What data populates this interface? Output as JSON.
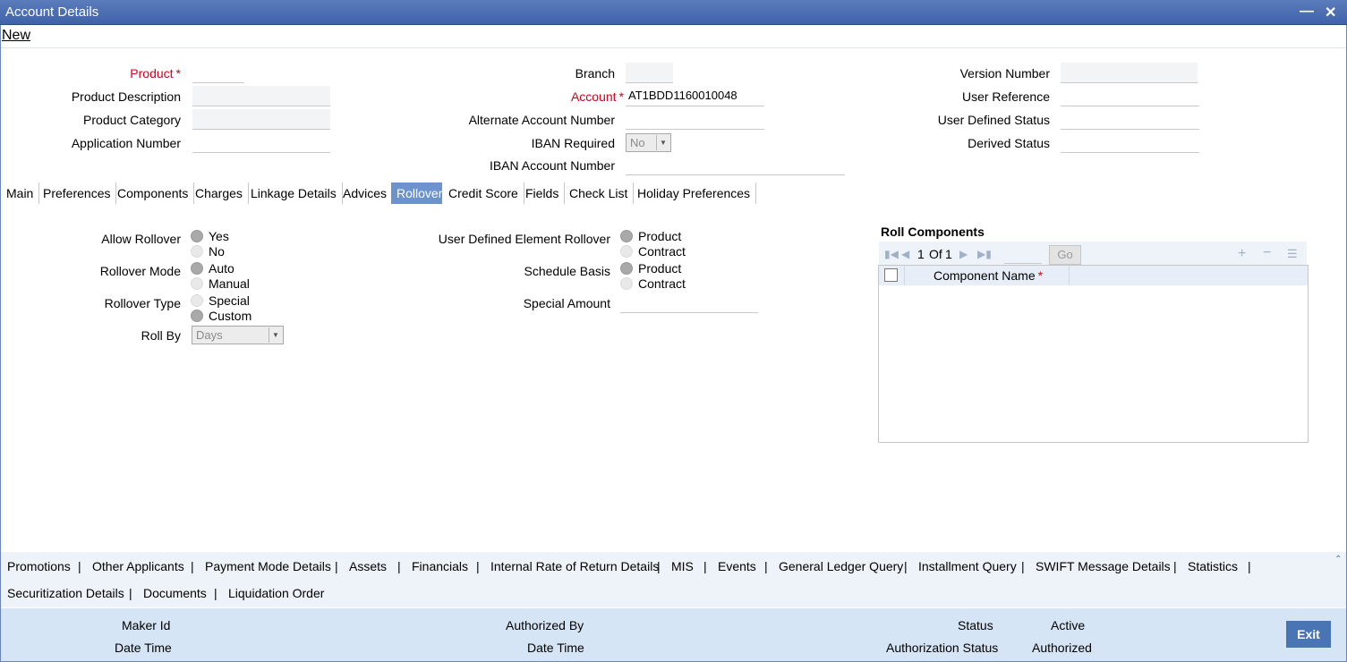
{
  "window": {
    "title": "Account Details",
    "minimize_icon": "minimize-icon",
    "close_icon": "close-icon"
  },
  "menu": {
    "new": "New"
  },
  "header": {
    "product_label": "Product",
    "product_value": "",
    "product_description_label": "Product Description",
    "product_category_label": "Product Category",
    "application_number_label": "Application Number",
    "branch_label": "Branch",
    "account_label": "Account",
    "account_value": "AT1BDD1160010048",
    "alternate_account_label": "Alternate Account Number",
    "iban_required_label": "IBAN Required",
    "iban_required_value": "No",
    "iban_account_label": "IBAN Account Number",
    "version_number_label": "Version Number",
    "user_reference_label": "User Reference",
    "user_defined_status_label": "User Defined Status",
    "derived_status_label": "Derived Status",
    "required_marker": "*"
  },
  "tabs": [
    "Main",
    "Preferences",
    "Components",
    "Charges",
    "Linkage Details",
    "Advices",
    "Rollover",
    "Credit Score",
    "Fields",
    "Check List",
    "Holiday Preferences"
  ],
  "active_tab": "Rollover",
  "rollover": {
    "allow_rollover_label": "Allow Rollover",
    "allow_yes": "Yes",
    "allow_no": "No",
    "rollover_mode_label": "Rollover Mode",
    "mode_auto": "Auto",
    "mode_manual": "Manual",
    "rollover_type_label": "Rollover Type",
    "type_special": "Special",
    "type_custom": "Custom",
    "roll_by_label": "Roll By",
    "roll_by_value": "Days",
    "ude_rollover_label": "User Defined Element Rollover",
    "ude_product": "Product",
    "ude_contract": "Contract",
    "schedule_basis_label": "Schedule Basis",
    "sched_product": "Product",
    "sched_contract": "Contract",
    "special_amount_label": "Special Amount"
  },
  "roll_components": {
    "title": "Roll Components",
    "page_current": "1",
    "page_of": "Of",
    "page_total": "1",
    "go": "Go",
    "column_component_name": "Component Name"
  },
  "sublinks": [
    "Promotions",
    "Other Applicants",
    "Payment Mode Details",
    "Assets",
    "Financials",
    "Internal Rate of Return Details",
    "MIS",
    "Events",
    "General Ledger Query",
    "Installment Query",
    "SWIFT Message Details",
    "Statistics",
    "Securitization Details",
    "Documents",
    "Liquidation Order"
  ],
  "separator": "|",
  "footer": {
    "maker_id": "Maker Id",
    "date_time": "Date Time",
    "authorized_by": "Authorized By",
    "status_label": "Status",
    "status_value": "Active",
    "auth_status_label": "Authorization Status",
    "auth_status_value": "Authorized",
    "exit": "Exit"
  },
  "colors": {
    "titlebar": "#4a6db0",
    "active_tab": "#6d93cf",
    "required": "#d4001c",
    "footer": "#d6e5f5",
    "exit_button": "#4a75b5"
  }
}
